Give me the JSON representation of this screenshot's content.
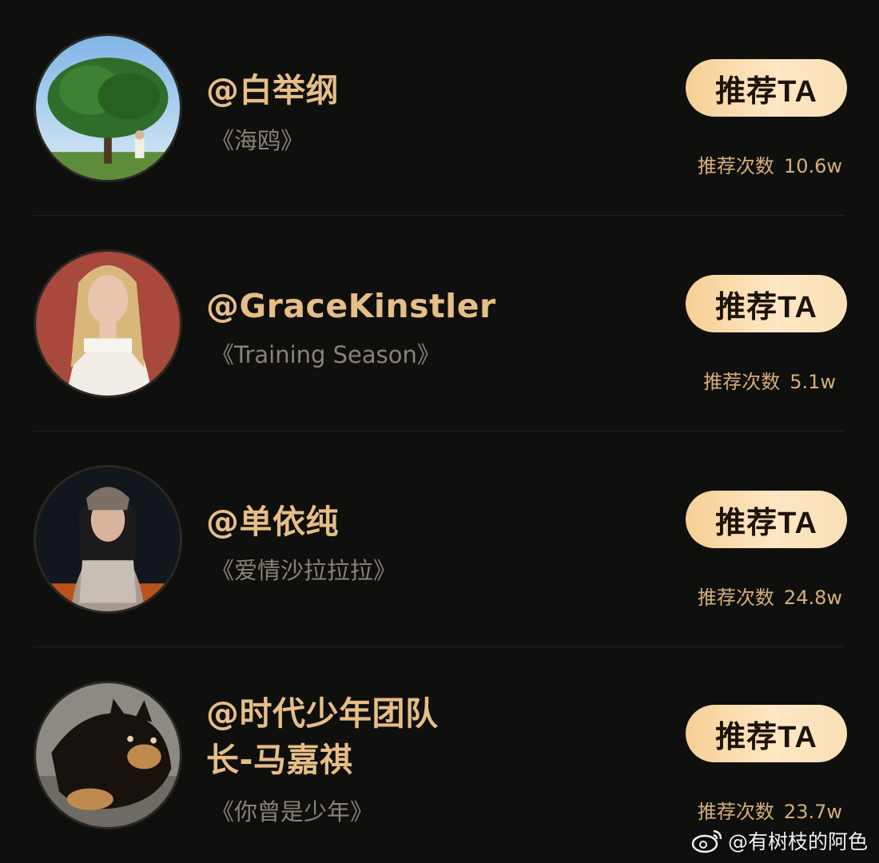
{
  "accent_color": "#e6be86",
  "button_gradient": [
    "#f6cf95",
    "#fde7c4"
  ],
  "rows": [
    {
      "name": "@白举纲",
      "song": "《海鸥》",
      "button": "推荐TA",
      "count_label": "推荐次数",
      "count_value": "10.6w",
      "avatar_icon": "tree-photo"
    },
    {
      "name": "@GraceKinstler",
      "song": "《Training Season》",
      "button": "推荐TA",
      "count_label": "推荐次数",
      "count_value": "5.1w",
      "avatar_icon": "portrait-photo"
    },
    {
      "name": "@单依纯",
      "song": "《爱情沙拉拉拉》",
      "button": "推荐TA",
      "count_label": "推荐次数",
      "count_value": "24.8w",
      "avatar_icon": "portrait-photo"
    },
    {
      "name_line1": "@时代少年团队",
      "name_line2": "长-马嘉祺",
      "song": "《你曾是少年》",
      "button": "推荐TA",
      "count_label": "推荐次数",
      "count_value": "23.7w",
      "avatar_icon": "dog-photo"
    }
  ],
  "watermark": "@有树枝的阿色"
}
